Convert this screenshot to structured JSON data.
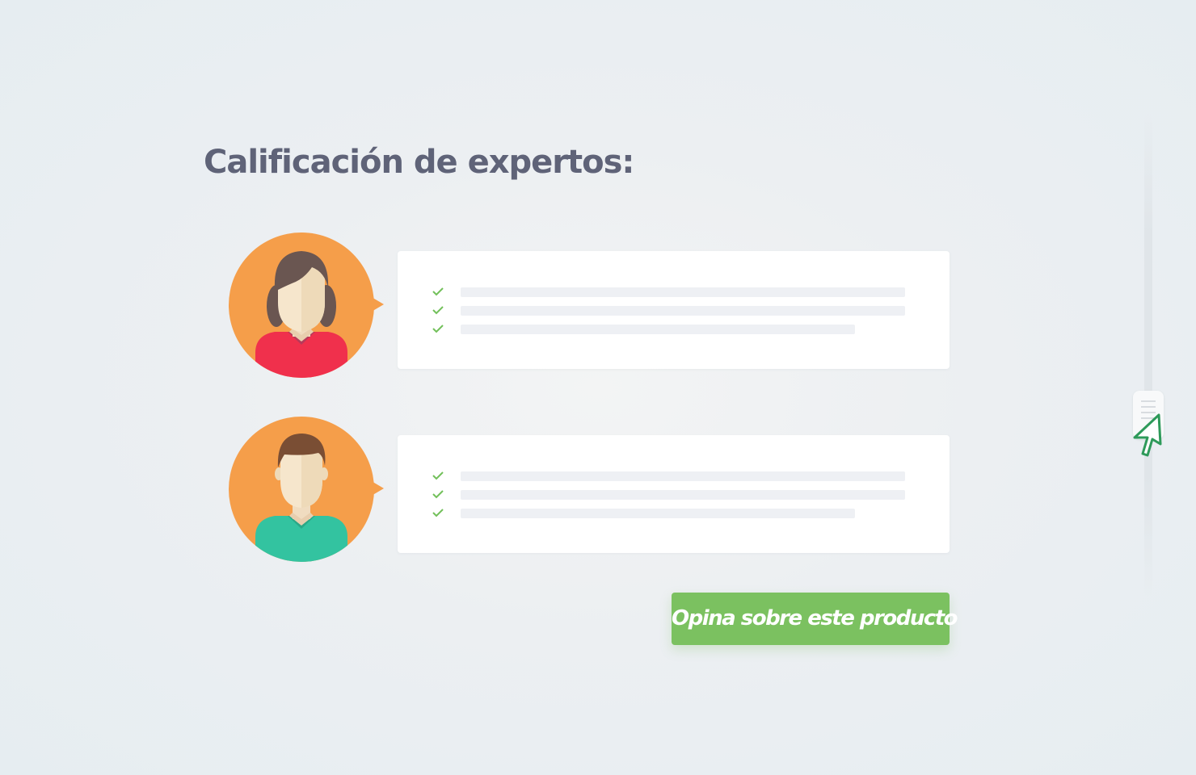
{
  "page_title": "Calificación de expertos:",
  "experts": [
    {
      "avatar_icon": "female-avatar-icon",
      "avatar_bg": "#f59e4a",
      "shirt_color": "#f0304c",
      "checklist": [
        {
          "icon": "check-icon"
        },
        {
          "icon": "check-icon"
        },
        {
          "icon": "check-icon"
        }
      ]
    },
    {
      "avatar_icon": "male-avatar-icon",
      "avatar_bg": "#f59e4a",
      "shirt_color": "#33c3a0",
      "checklist": [
        {
          "icon": "check-icon"
        },
        {
          "icon": "check-icon"
        },
        {
          "icon": "check-icon"
        }
      ]
    }
  ],
  "cta_button": {
    "label": "Opina sobre este producto",
    "color": "#7bc160"
  },
  "colors": {
    "check": "#72c05a",
    "title": "#5f6378",
    "cursor_outline": "#2e9a5a"
  },
  "cursor_icon": "pointer-cursor-icon"
}
